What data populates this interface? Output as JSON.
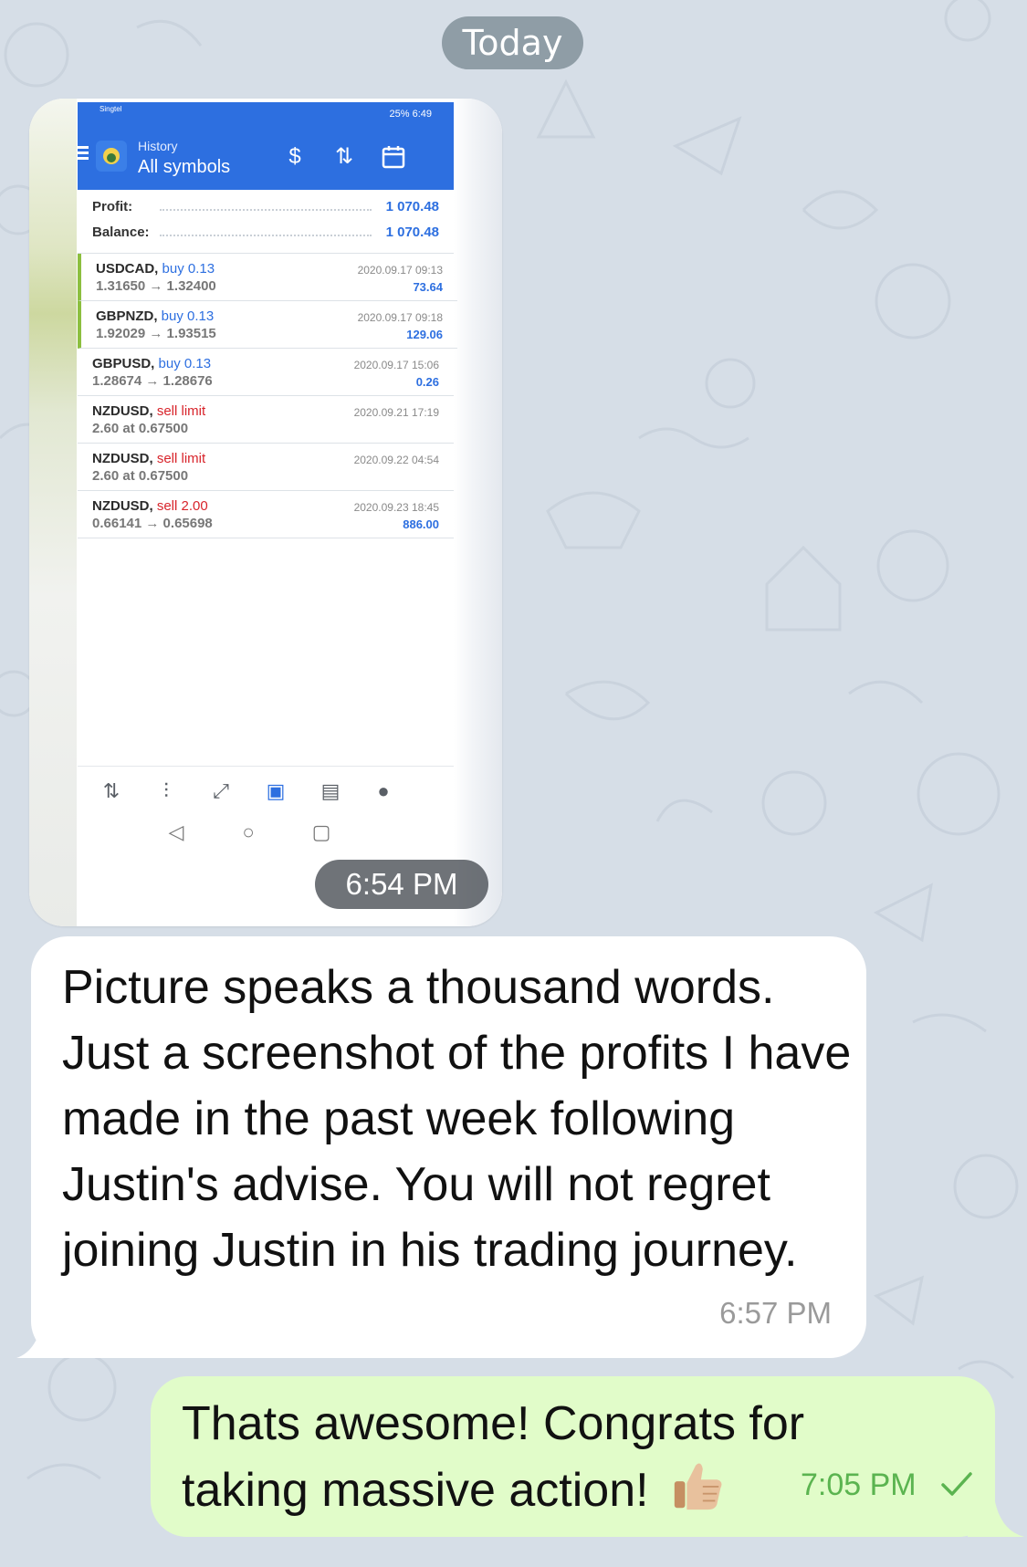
{
  "chat": {
    "date_chip": "Today",
    "photo_time": "6:54 PM",
    "incoming_text": "Picture speaks a thousand words. Just a screenshot of the profits I have made in the past week following Justin's advise. You will not regret joining Justin in his trading journey.",
    "incoming_time": "6:57 PM",
    "outgoing_text": "Thats awesome! Congrats for taking massive action!",
    "outgoing_time": "7:05 PM"
  },
  "screenshot": {
    "status_left": "Singtel",
    "status_right": "25%  6:49",
    "app_subtitle": "History",
    "app_title": "All symbols",
    "profit_label": "Profit:",
    "profit_value": "1 070.48",
    "balance_label": "Balance:",
    "balance_value": "1 070.48",
    "trades": [
      {
        "symbol": "USDCAD,",
        "side": "buy 0.13",
        "side_type": "buy",
        "prices": "1.31650 → 1.32400",
        "time": "2020.09.17 09:13",
        "pl": "73.64"
      },
      {
        "symbol": "GBPNZD,",
        "side": "buy 0.13",
        "side_type": "buy",
        "prices": "1.92029 → 1.93515",
        "time": "2020.09.17 09:18",
        "pl": "129.06"
      },
      {
        "symbol": "GBPUSD,",
        "side": "buy 0.13",
        "side_type": "buy",
        "prices": "1.28674 → 1.28676",
        "time": "2020.09.17 15:06",
        "pl": "0.26"
      },
      {
        "symbol": "NZDUSD,",
        "side": "sell limit",
        "side_type": "sell",
        "prices": "2.60 at 0.67500",
        "time": "2020.09.21 17:19",
        "pl": ""
      },
      {
        "symbol": "NZDUSD,",
        "side": "sell limit",
        "side_type": "sell",
        "prices": "2.60 at 0.67500",
        "time": "2020.09.22 04:54",
        "pl": ""
      },
      {
        "symbol": "NZDUSD,",
        "side": "sell 2.00",
        "side_type": "sell",
        "prices": "0.66141 → 0.65698",
        "time": "2020.09.23 18:45",
        "pl": "886.00"
      }
    ]
  },
  "colors": {
    "wallpaper": "#d6dee7",
    "app_bar": "#2d6fe0",
    "outgoing_bubble": "#e1fcc9",
    "outgoing_time": "#5bb450",
    "buy": "#2d6fe0",
    "sell": "#d8242b"
  }
}
